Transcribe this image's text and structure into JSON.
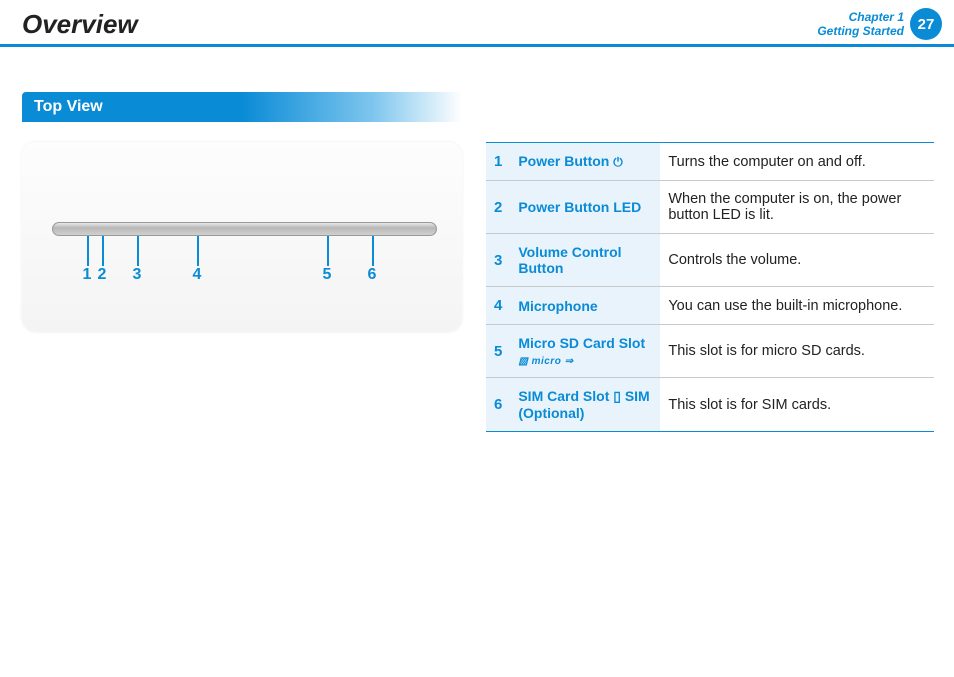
{
  "header": {
    "title": "Overview",
    "chapter_line1": "Chapter 1",
    "chapter_line2": "Getting Started",
    "page_number": "27"
  },
  "section": {
    "title": "Top View"
  },
  "callouts": [
    "1",
    "2",
    "3",
    "4",
    "5",
    "6"
  ],
  "table": [
    {
      "num": "1",
      "name": "Power Button ",
      "icon": "⏻",
      "desc": "Turns the computer on and off."
    },
    {
      "num": "2",
      "name": "Power Button LED",
      "icon": "",
      "desc": "When the computer is on, the power button LED is lit."
    },
    {
      "num": "3",
      "name": "Volume Control Button",
      "icon": "",
      "desc": "Controls the volume."
    },
    {
      "num": "4",
      "name": "Microphone",
      "icon": "",
      "desc": "You can use the built-in microphone."
    },
    {
      "num": "5",
      "name": "Micro SD Card Slot",
      "icon": "▧ micro ⇒",
      "desc": "This slot is for micro SD cards."
    },
    {
      "num": "6",
      "name": "SIM Card Slot ▯ SIM (Optional)",
      "icon": "",
      "desc": "This slot is for SIM cards."
    }
  ]
}
